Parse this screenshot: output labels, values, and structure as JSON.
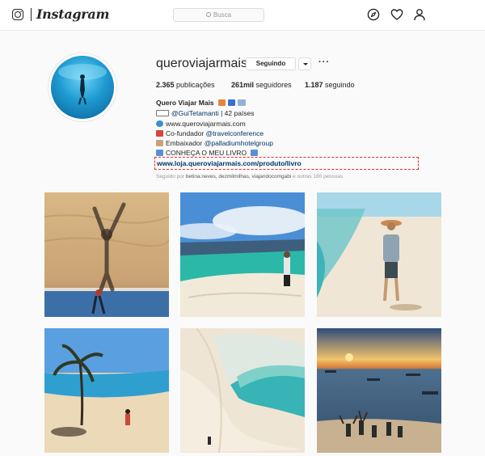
{
  "header": {
    "wordmark": "Instagram",
    "search_placeholder": "Busca",
    "icons": [
      "camera-logo-icon",
      "compass-icon",
      "heart-icon",
      "person-icon"
    ]
  },
  "profile": {
    "username": "queroviajarmais",
    "follow_label": "Seguindo",
    "more_label": "···",
    "stats": {
      "posts_count": "2.365",
      "posts_label": "publicações",
      "followers_count": "261mil",
      "followers_label": "seguidores",
      "following_count": "1.187",
      "following_label": "seguindo"
    },
    "bio": {
      "name": "Quero Viajar Mais",
      "line1_mention": "@GuiTetamanti",
      "line1_rest": "| 42 países",
      "line2": "www.queroviajarmais.com",
      "line3_text": "Co-fundador",
      "line3_mention": "@travelconference",
      "line4_text": "Embaixador",
      "line4_mention": "@palladiumhotelgroup",
      "line5": "CONHEÇA O MEU LIVRO",
      "website": "www.loja.queroviajarmais.com/produto/livro"
    },
    "followed_by": {
      "prefix": "Seguido por",
      "names": "betina.neves, dezmilmilhas, viajandocomgabi",
      "suffix": "e outras 180 pessoas"
    }
  },
  "posts": [
    {
      "scene": "dune-shadow-reflection"
    },
    {
      "scene": "blue-lagoon-dunes"
    },
    {
      "scene": "man-hat-lagoon"
    },
    {
      "scene": "palm-tree-lagoon"
    },
    {
      "scene": "aerial-lagoon-dunes"
    },
    {
      "scene": "sunset-beach-group"
    }
  ],
  "colors": {
    "link": "#003569",
    "text": "#262626",
    "muted": "#999999",
    "border": "#dbdbdb",
    "highlight_box": "#e0302b"
  }
}
